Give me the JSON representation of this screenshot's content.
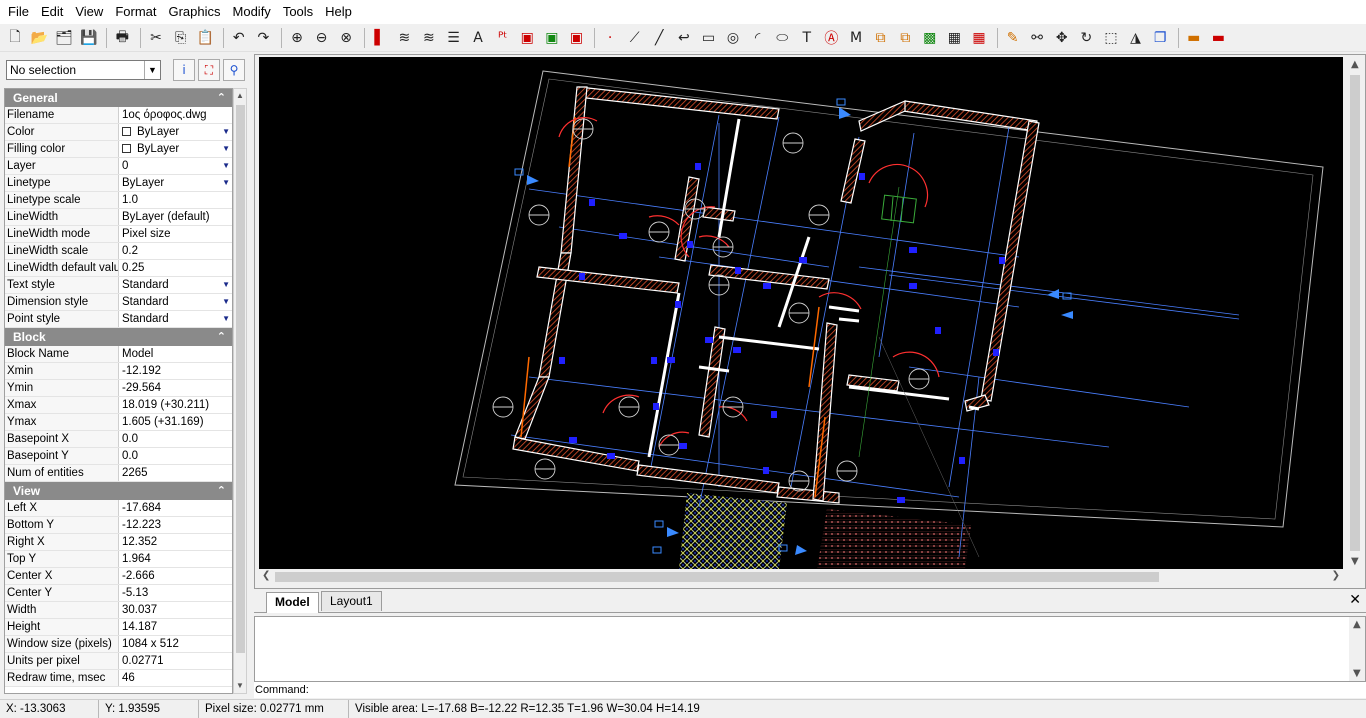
{
  "menu": [
    "File",
    "Edit",
    "View",
    "Format",
    "Graphics",
    "Modify",
    "Tools",
    "Help"
  ],
  "selection": {
    "value": "No selection"
  },
  "general": {
    "title": "General",
    "rows": [
      {
        "name": "Filename",
        "value": "1ος όροφος.dwg"
      },
      {
        "name": "Color",
        "value": "ByLayer"
      },
      {
        "name": "Filling color",
        "value": "ByLayer"
      },
      {
        "name": "Layer",
        "value": "0"
      },
      {
        "name": "Linetype",
        "value": "ByLayer"
      },
      {
        "name": "Linetype scale",
        "value": "1.0"
      },
      {
        "name": "LineWidth",
        "value": "ByLayer (default)"
      },
      {
        "name": "LineWidth mode",
        "value": "Pixel size"
      },
      {
        "name": "LineWidth scale",
        "value": "0.2"
      },
      {
        "name": "LineWidth default value",
        "value": "0.25"
      },
      {
        "name": "Text style",
        "value": "Standard"
      },
      {
        "name": "Dimension style",
        "value": "Standard"
      },
      {
        "name": "Point style",
        "value": "Standard"
      }
    ]
  },
  "block": {
    "title": "Block",
    "rows": [
      {
        "name": "Block Name",
        "value": "Model"
      },
      {
        "name": "Xmin",
        "value": "-12.192"
      },
      {
        "name": "Ymin",
        "value": "-29.564"
      },
      {
        "name": "Xmax",
        "value": "18.019  (+30.211)"
      },
      {
        "name": "Ymax",
        "value": "1.605  (+31.169)"
      },
      {
        "name": "Basepoint X",
        "value": "0.0"
      },
      {
        "name": "Basepoint Y",
        "value": "0.0"
      },
      {
        "name": "Num of entities",
        "value": "2265"
      }
    ]
  },
  "view": {
    "title": "View",
    "rows": [
      {
        "name": "Left X",
        "value": "-17.684"
      },
      {
        "name": "Bottom Y",
        "value": "-12.223"
      },
      {
        "name": "Right X",
        "value": "12.352"
      },
      {
        "name": "Top Y",
        "value": "1.964"
      },
      {
        "name": "Center X",
        "value": "-2.666"
      },
      {
        "name": "Center Y",
        "value": "-5.13"
      },
      {
        "name": "Width",
        "value": "30.037"
      },
      {
        "name": "Height",
        "value": "14.187"
      },
      {
        "name": "Window size (pixels)",
        "value": "1084 x 512"
      },
      {
        "name": "Units per pixel",
        "value": "0.02771"
      },
      {
        "name": "Redraw time, msec",
        "value": "46"
      }
    ]
  },
  "tabs": {
    "model": "Model",
    "layout1": "Layout1"
  },
  "command": {
    "label": "Command:"
  },
  "status": {
    "x": "X: -13.3063",
    "y": "Y: 1.93595",
    "pixel": "Pixel size: 0.02771 mm",
    "visible": "Visible area:  L=-17.68  B=-12.22  R=12.35  T=1.96  W=30.04  H=14.19"
  },
  "colors": {
    "walls": "#ffffff",
    "hatch": "#e0502a",
    "axes": "#4a7fff",
    "blocks": "#1a1aff",
    "doors": "#ff3030",
    "paving": "#d8e060"
  }
}
